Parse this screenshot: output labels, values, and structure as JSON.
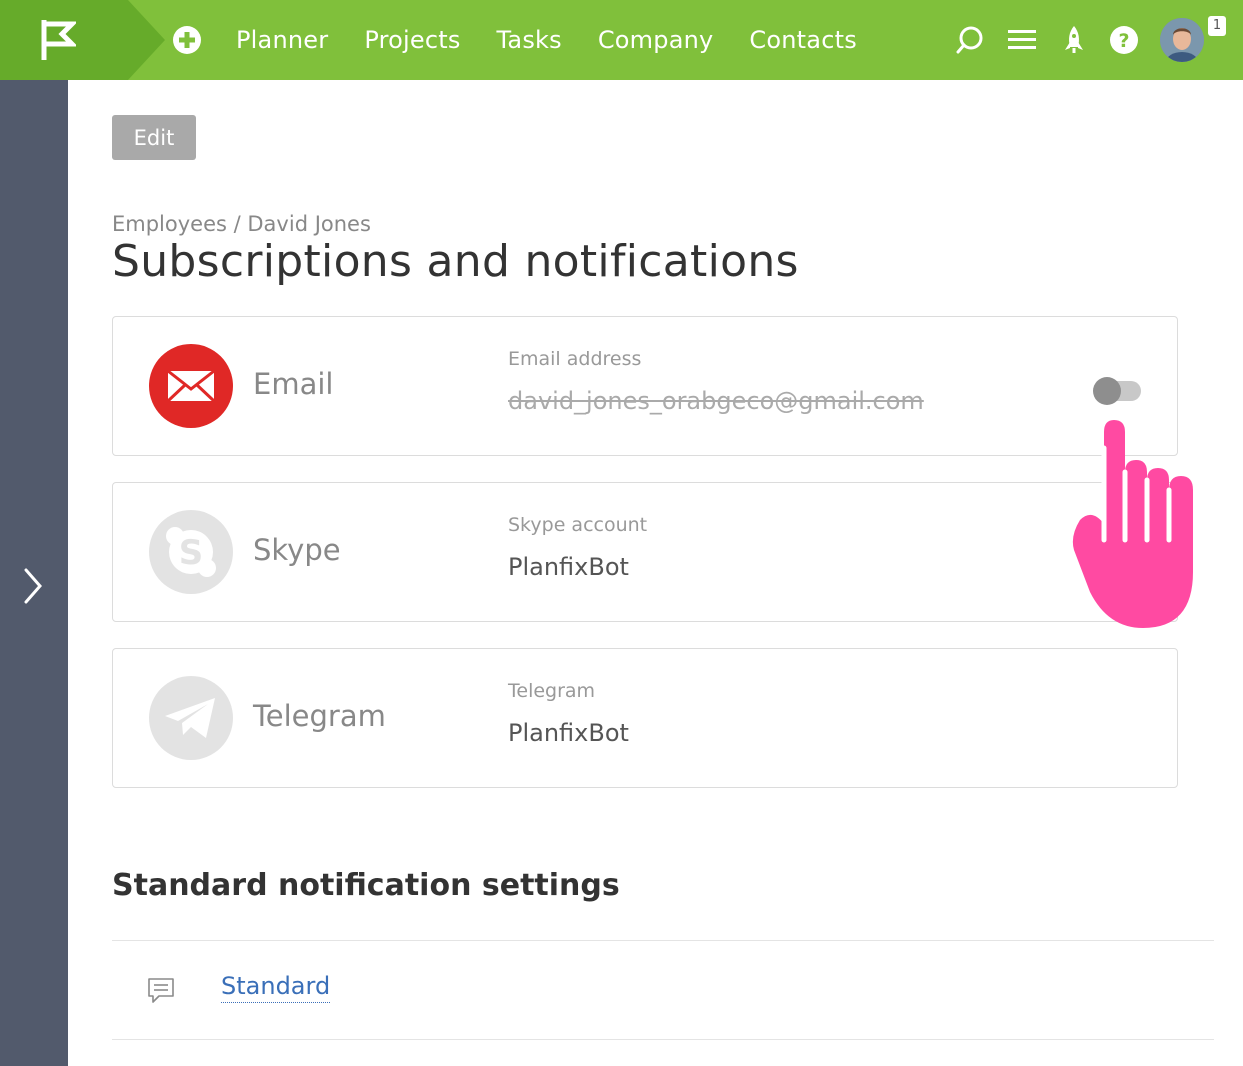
{
  "header": {
    "nav": [
      "Planner",
      "Projects",
      "Tasks",
      "Company",
      "Contacts"
    ],
    "notification_count": "1",
    "accent_color": "#80c03b"
  },
  "toolbar": {
    "edit_label": "Edit"
  },
  "breadcrumb": {
    "parent": "Employees",
    "separator": " / ",
    "current": "David Jones"
  },
  "page_title": "Subscriptions and notifications",
  "channels": [
    {
      "name": "Email",
      "field_label": "Email address",
      "field_value": "david_jones_orabgeco@gmail.com",
      "icon": "envelope-icon",
      "color": "#e02826",
      "enabled": false
    },
    {
      "name": "Skype",
      "field_label": "Skype account",
      "field_value": "PlanfixBot",
      "icon": "skype-icon",
      "color": "#e3e3e3"
    },
    {
      "name": "Telegram",
      "field_label": "Telegram",
      "field_value": "PlanfixBot",
      "icon": "telegram-icon",
      "color": "#e3e3e3"
    }
  ],
  "standard_section": {
    "title": "Standard notification settings",
    "link_label": "Standard"
  }
}
